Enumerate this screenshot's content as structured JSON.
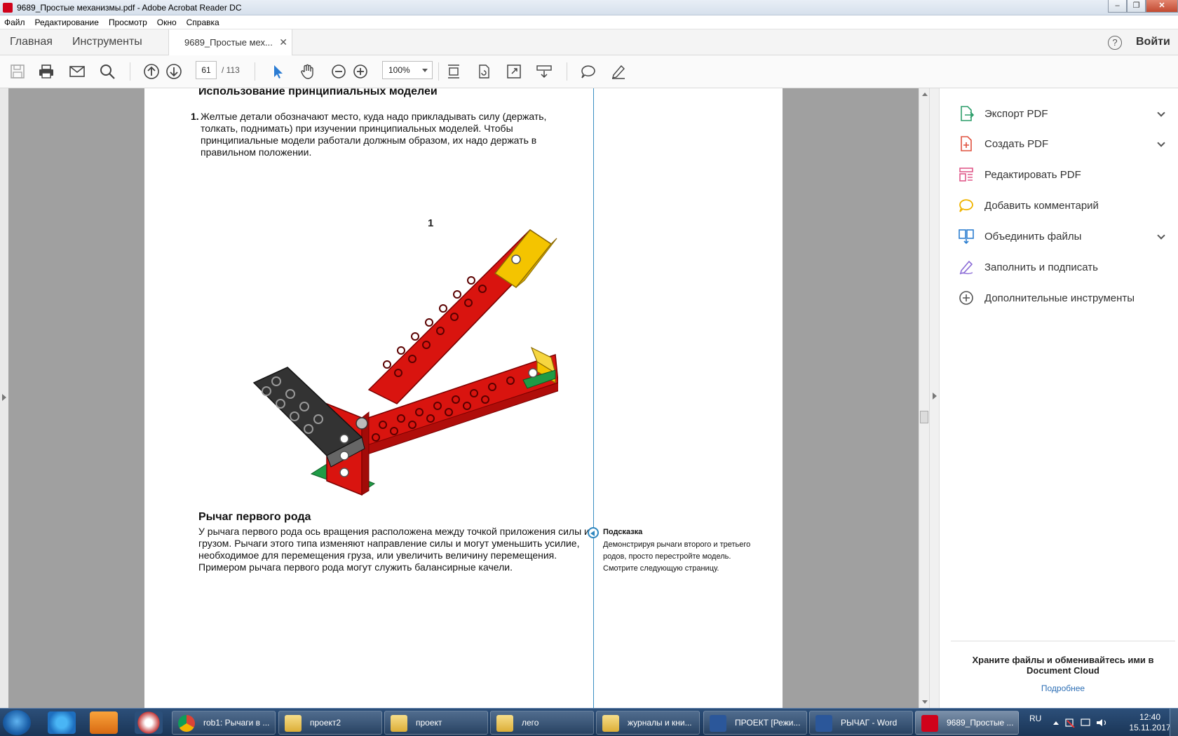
{
  "window": {
    "title": "9689_Простые механизмы.pdf - Adobe Acrobat Reader DC",
    "controls": [
      "minimize",
      "restore",
      "close"
    ]
  },
  "menu": [
    "Файл",
    "Редактирование",
    "Просмотр",
    "Окно",
    "Справка"
  ],
  "tabs": {
    "home": "Главная",
    "tools": "Инструменты",
    "document": "9689_Простые мех...",
    "login": "Войти"
  },
  "toolbar": {
    "page_current": "61",
    "page_total": "/ 113",
    "zoom": "100%",
    "icons": [
      "save-icon",
      "print-icon",
      "email-icon",
      "search-icon",
      "page-up-icon",
      "page-down-icon",
      "select-tool-icon",
      "hand-tool-icon",
      "zoom-out-icon",
      "zoom-in-icon",
      "fit-page-icon",
      "rotate-icon",
      "fullscreen-icon",
      "read-mode-icon",
      "comment-icon",
      "sign-icon"
    ]
  },
  "document": {
    "heading_top": "Использование принципиальных моделей",
    "list_number": "1.",
    "list_text": "Желтые детали обозначают место, куда надо прикладывать силу (держать, толкать, поднимать) при изучении принципиальных моделей. Чтобы принципиальные модели работали должным образом, их надо держать в правильном положении.",
    "figure_label": "1",
    "section_heading": "Рычаг первого рода",
    "section_text": "У рычага первого рода ось вращения расположена между точкой приложения силы и грузом. Рычаги этого типа изменяют направление силы и могут уменьшить усилие, необходимое для перемещения груза, или увеличить величину перемещения. Примером рычага первого рода могут служить балансирные качели.",
    "hint_title": "Подсказка",
    "hint_text": "Демонстрируя рычаги второго и третьего родов, просто перестройте модель. Смотрите следующую страницу."
  },
  "right_panel": {
    "tools": [
      {
        "label": "Экспорт PDF",
        "icon": "export-pdf-icon",
        "color": "#2e9e6b",
        "expandable": true
      },
      {
        "label": "Создать PDF",
        "icon": "create-pdf-icon",
        "color": "#e0523f",
        "expandable": true
      },
      {
        "label": "Редактировать PDF",
        "icon": "edit-pdf-icon",
        "color": "#e05a8a",
        "expandable": false
      },
      {
        "label": "Добавить комментарий",
        "icon": "comment-icon",
        "color": "#f0b400",
        "expandable": false
      },
      {
        "label": "Объединить файлы",
        "icon": "combine-files-icon",
        "color": "#2d7fd0",
        "expandable": true
      },
      {
        "label": "Заполнить и подписать",
        "icon": "fill-sign-icon",
        "color": "#8a6ad6",
        "expandable": false
      },
      {
        "label": "Дополнительные инструменты",
        "icon": "more-tools-icon",
        "color": "#555555",
        "expandable": false
      }
    ],
    "cloud_text": "Храните файлы и обменивайтесь ими в Document Cloud",
    "cloud_link": "Подробнее"
  },
  "taskbar": {
    "tasks": [
      {
        "label": "rob1: Рычаги в ...",
        "icon": "chrome-icon",
        "active": false
      },
      {
        "label": "проект2",
        "icon": "folder-icon",
        "active": false
      },
      {
        "label": "проект",
        "icon": "folder-icon",
        "active": false
      },
      {
        "label": "лего",
        "icon": "folder-icon",
        "active": false
      },
      {
        "label": "журналы и кни...",
        "icon": "folder-icon",
        "active": false
      },
      {
        "label": "ПРОЕКТ [Режи...",
        "icon": "word-icon",
        "active": false
      },
      {
        "label": "РЫЧАГ - Word",
        "icon": "word-icon",
        "active": false
      },
      {
        "label": "9689_Простые ...",
        "icon": "acrobat-icon",
        "active": true
      }
    ],
    "lang": "RU",
    "time": "12:40",
    "date": "15.11.2017"
  }
}
